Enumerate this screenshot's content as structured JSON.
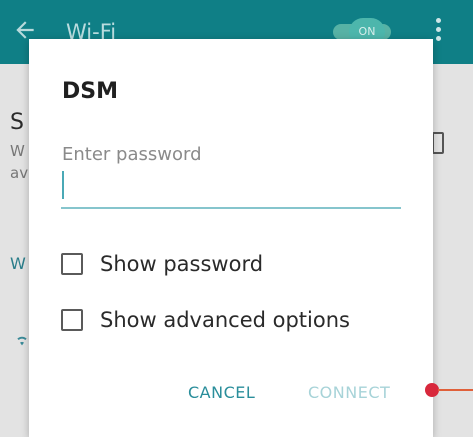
{
  "background": {
    "appbar_title": "Wi-Fi",
    "toggle_label": "ON",
    "partial_letters": {
      "s": "S",
      "w1": "W",
      "w2": "av",
      "w3": "W"
    }
  },
  "dialog": {
    "network_name": "DSM",
    "password_label": "Enter password",
    "password_value": "",
    "checkboxes": [
      {
        "label": "Show password",
        "checked": false
      },
      {
        "label": "Show advanced options",
        "checked": false
      }
    ],
    "buttons": {
      "cancel": "CANCEL",
      "connect": "CONNECT"
    }
  },
  "colors": {
    "accent": "#2a8e9b",
    "appbar": "#0f7f86",
    "disabled_button": "#a7d3d8",
    "touch_marker": "#d8283c"
  },
  "icons": [
    "back-arrow-icon",
    "more-vert-icon",
    "wifi-icon"
  ]
}
